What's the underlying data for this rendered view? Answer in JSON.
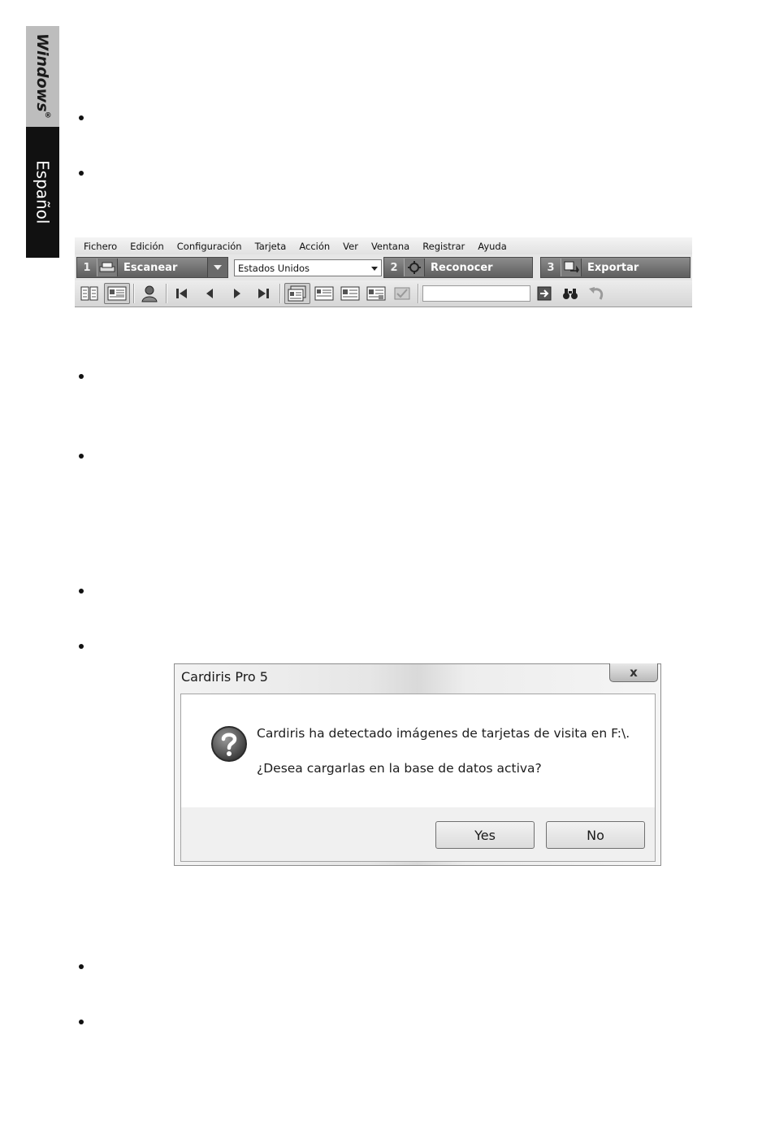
{
  "side_tabs": {
    "os": "Windows",
    "os_mark": "®",
    "language": "Español"
  },
  "toolbar": {
    "menu": [
      "Fichero",
      "Edición",
      "Configuración",
      "Tarjeta",
      "Acción",
      "Ver",
      "Ventana",
      "Registrar",
      "Ayuda"
    ],
    "steps": [
      {
        "number": "1",
        "label": "Escanear",
        "icon": "scanner-icon"
      },
      {
        "number": "2",
        "label": "Reconocer",
        "icon": "recognize-icon"
      },
      {
        "number": "3",
        "label": "Exportar",
        "icon": "export-icon"
      }
    ],
    "country_select": {
      "value": "Estados Unidos"
    },
    "search": {
      "value": ""
    }
  },
  "dialog": {
    "title": "Cardiris Pro 5",
    "close_glyph": "x",
    "message_line1": "Cardiris ha detectado imágenes de tarjetas de visita en F:\\.",
    "message_line2": "¿Desea cargarlas en la base de datos activa?",
    "yes_label": "Yes",
    "no_label": "No"
  }
}
